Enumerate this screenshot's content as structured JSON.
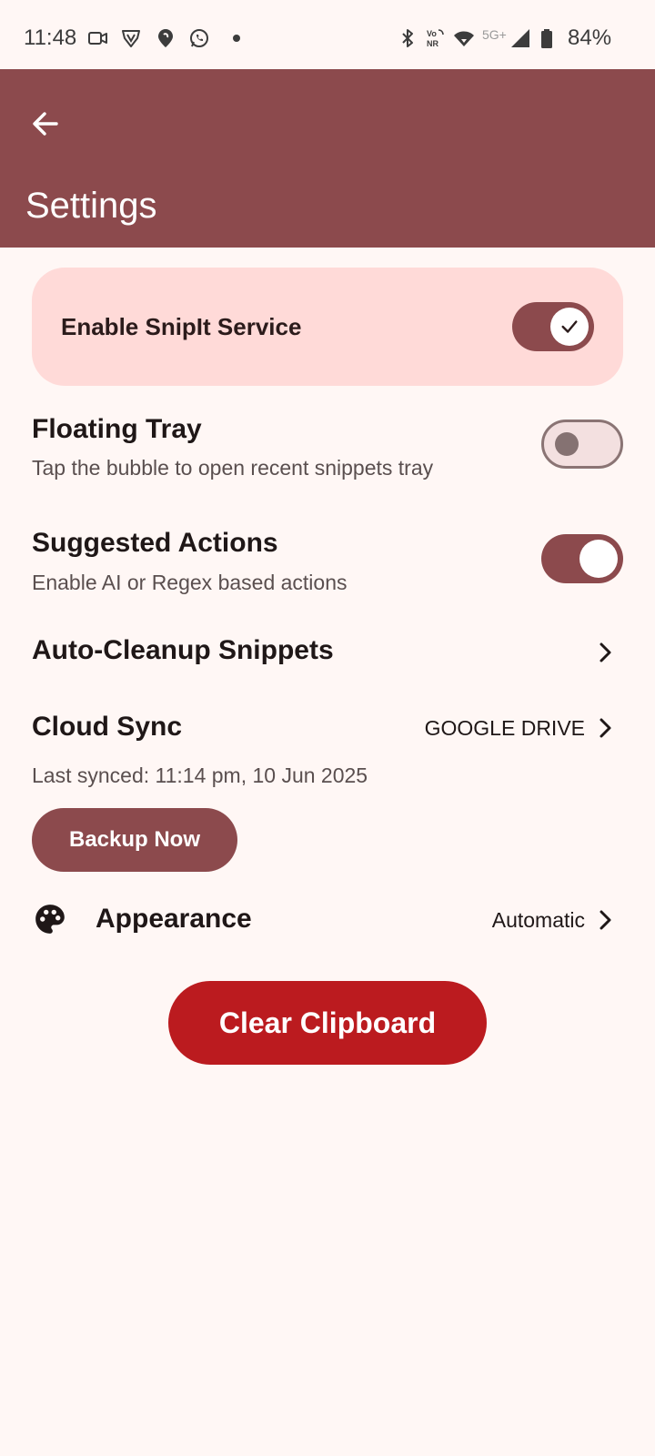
{
  "status_bar": {
    "time": "11:48",
    "battery": "84%",
    "network_label": "5G+",
    "icons": [
      "video-camera-icon",
      "vpn-shield-icon",
      "location-pin-icon",
      "whatsapp-icon",
      "notification-dot-icon",
      "bluetooth-icon",
      "vonr-icon",
      "wifi-icon",
      "signal-icon",
      "battery-icon"
    ]
  },
  "app_bar": {
    "title": "Settings",
    "back_icon": "arrow-back-icon"
  },
  "service": {
    "label": "Enable SnipIt Service",
    "enabled": true
  },
  "floating_tray": {
    "title": "Floating Tray",
    "subtitle": "Tap the bubble to open recent snippets tray",
    "enabled": false
  },
  "suggested_actions": {
    "title": "Suggested Actions",
    "subtitle": "Enable AI or Regex based actions",
    "enabled": true
  },
  "auto_cleanup": {
    "title": "Auto-Cleanup Snippets"
  },
  "cloud_sync": {
    "title": "Cloud Sync",
    "value": "GOOGLE DRIVE",
    "last_synced": "Last synced: 11:14 pm, 10 Jun 2025",
    "backup_label": "Backup Now"
  },
  "appearance": {
    "title": "Appearance",
    "value": "Automatic",
    "icon": "palette-icon"
  },
  "clear_label": "Clear Clipboard",
  "colors": {
    "primary": "#8C4A4D",
    "background": "#FFF7F5",
    "card": "#FFDAD8",
    "danger": "#BB1B1F"
  }
}
